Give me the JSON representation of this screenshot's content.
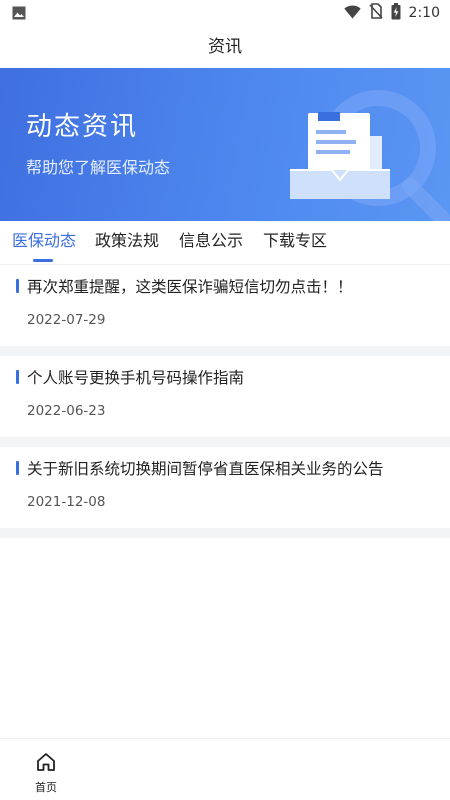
{
  "status_bar": {
    "time": "2:10",
    "icons": [
      "image-icon",
      "wifi-icon",
      "no-sim-icon",
      "battery-charging-icon"
    ]
  },
  "header": {
    "title": "资讯"
  },
  "banner": {
    "title": "动态资讯",
    "subtitle": "帮助您了解医保动态"
  },
  "tabs": [
    {
      "label": "医保动态",
      "active": true
    },
    {
      "label": "政策法规",
      "active": false
    },
    {
      "label": "信息公示",
      "active": false
    },
    {
      "label": "下载专区",
      "active": false
    }
  ],
  "news": [
    {
      "title": "再次郑重提醒，这类医保诈骗短信切勿点击！！",
      "date": "2022-07-29"
    },
    {
      "title": "个人账号更换手机号码操作指南",
      "date": "2022-06-23"
    },
    {
      "title": "关于新旧系统切换期间暂停省直医保相关业务的公告",
      "date": "2021-12-08"
    }
  ],
  "bottom_nav": {
    "home_label": "首页",
    "home_icon": "home-icon"
  },
  "colors": {
    "accent": "#3a6fe0",
    "banner_start": "#3f6fe0",
    "banner_end": "#5a96f3"
  }
}
